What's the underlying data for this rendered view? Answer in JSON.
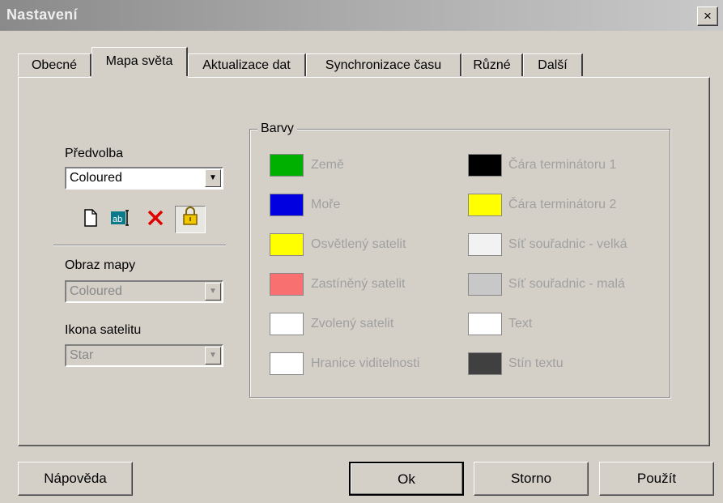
{
  "window": {
    "title": "Nastavení",
    "close_label": "×"
  },
  "tabs": [
    {
      "label": "Obecné"
    },
    {
      "label": "Mapa světa",
      "active": true
    },
    {
      "label": "Aktualizace dat"
    },
    {
      "label": "Synchronizace času"
    },
    {
      "label": "Různé"
    },
    {
      "label": "Další"
    }
  ],
  "preset": {
    "label": "Předvolba",
    "value": "Coloured",
    "icons": [
      "new-document-icon",
      "rename-icon",
      "delete-icon",
      "lock-icon"
    ]
  },
  "map_image": {
    "label": "Obraz mapy",
    "value": "Coloured",
    "disabled": true
  },
  "satellite_icon": {
    "label": "Ikona satelitu",
    "value": "Star",
    "disabled": true
  },
  "colors": {
    "title": "Barvy",
    "left": [
      {
        "label": "Země",
        "color": "#00b000"
      },
      {
        "label": "Moře",
        "color": "#0000e0"
      },
      {
        "label": "Osvětlený satelit",
        "color": "#ffff00"
      },
      {
        "label": "Zastíněný satelit",
        "color": "#f87070"
      },
      {
        "label": "Zvolený satelit",
        "color": "#ffffff"
      },
      {
        "label": "Hranice viditelnosti",
        "color": "#ffffff"
      }
    ],
    "right": [
      {
        "label": "Čára terminátoru 1",
        "color": "#000000"
      },
      {
        "label": "Čára terminátoru 2",
        "color": "#ffff00"
      },
      {
        "label": "Síť souřadnic - velká",
        "color": "#f2f2f2"
      },
      {
        "label": "Síť souřadnic - malá",
        "color": "#c8c8c8"
      },
      {
        "label": "Text",
        "color": "#ffffff"
      },
      {
        "label": "Stín textu",
        "color": "#404040"
      }
    ]
  },
  "buttons": {
    "help": "Nápověda",
    "ok": "Ok",
    "cancel": "Storno",
    "apply": "Použít"
  }
}
